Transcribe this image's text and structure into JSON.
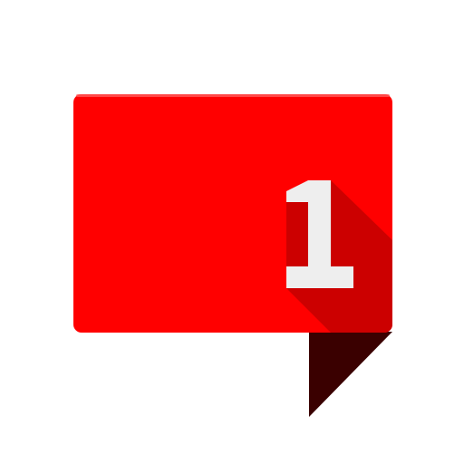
{
  "icon": {
    "name": "notification-speech-bubble-icon",
    "badge_text": "1"
  },
  "colors": {
    "bubble_fill": "#ff0000",
    "bubble_highlight": "#ff5a5a",
    "long_shadow": "#cc0000",
    "tail_fill": "#3a0000",
    "digit_fill": "#eeeeee",
    "background": "#ffffff"
  }
}
